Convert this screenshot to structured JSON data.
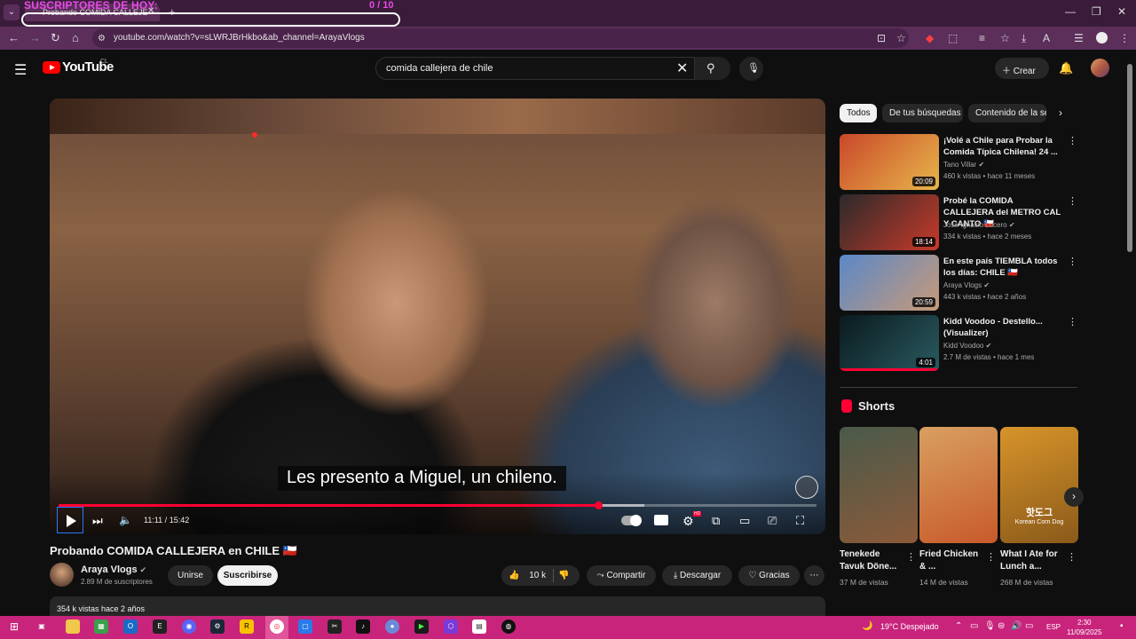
{
  "browser": {
    "overlay_title": "SUSCRIPTORES DE HOY:",
    "overlay_count": "0  / 10",
    "tab_title": "Probando COMIDA CALLEJE",
    "url": "youtube.com/watch?v=sLWRJBrHkbo&ab_channel=ArayaVlogs"
  },
  "header": {
    "logo_text": "YouTube",
    "region": "CL",
    "search_value": "comida callejera de chile",
    "create_label": "Crear"
  },
  "player": {
    "caption": "Les presento a Miguel, un chileno.",
    "time": "11:11 / 15:42",
    "progress_fraction": 0.712,
    "hd_label": "HD"
  },
  "video": {
    "title": "Probando COMIDA CALLEJERA en CHILE 🇨🇱",
    "channel_name": "Araya Vlogs",
    "subscribers": "2.89 M de suscriptores",
    "join_label": "Unirse",
    "subscribe_label": "Suscribirse",
    "likes": "10 k",
    "share_label": "Compartir",
    "download_label": "Descargar",
    "thanks_label": "Gracias",
    "description_stats": "354 k vistas  hace 2 años"
  },
  "sidebar": {
    "chips": [
      "Todos",
      "De tus búsquedas",
      "Contenido de la se"
    ],
    "recommendations": [
      {
        "title": "¡Volé a Chile para Probar la Comida Típica Chilena! 24 ...",
        "channel": "Tano Villar",
        "meta": "460 k vistas • hace 11 meses",
        "duration": "20:09",
        "color_a": "#c9482a",
        "color_b": "#e8b64a"
      },
      {
        "title": "Probé la COMIDA CALLEJERA del METRO CAL Y CANTO 🇨🇱",
        "channel": "Jose Ignacio Lucero",
        "meta": "334 k vistas • hace 2 meses",
        "duration": "18:14",
        "color_a": "#2a2a2a",
        "color_b": "#c83a2a"
      },
      {
        "title": "En este país TIEMBLA todos los días: CHILE 🇨🇱",
        "channel": "Araya Vlogs",
        "meta": "443 k vistas • hace 2 años",
        "duration": "20:59",
        "color_a": "#5a88c8",
        "color_b": "#c89a78"
      },
      {
        "title": "Kidd Voodoo - Destello... (Visualizer)",
        "channel": "Kidd Voodoo",
        "meta": "2.7 M de vistas • hace 1 mes",
        "duration": "4:01",
        "color_a": "#0a1a1e",
        "color_b": "#2a5a60",
        "watched_fraction": 1.0
      }
    ],
    "shorts_title": "Shorts",
    "shorts": [
      {
        "title": "Tenekede Tavuk Döne...",
        "views": "37 M de vistas",
        "color_a": "#4a5a4a",
        "color_b": "#8a5a3a"
      },
      {
        "title": "Fried Chicken & ...",
        "views": "14 M de vistas",
        "color_a": "#d8a060",
        "color_b": "#c85a2a"
      },
      {
        "title": "What I Ate for Lunch a...",
        "views": "268 M de vistas",
        "color_a": "#d8942a",
        "color_b": "#8a5a1a",
        "overlay": "핫도그",
        "overlay_sub": "Korean Corn Dog"
      }
    ]
  },
  "taskbar": {
    "weather": "19°C  Despejado",
    "lang": "ESP",
    "time": "2:30",
    "date": "11/09/2025"
  }
}
